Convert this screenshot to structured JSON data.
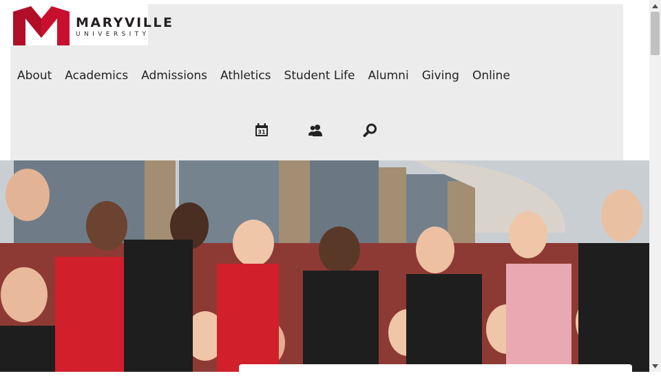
{
  "logo": {
    "name": "MARYVILLE",
    "sub": "UNIVERSITY",
    "brand_color": "#c8102e"
  },
  "nav": {
    "items": [
      {
        "label": "About"
      },
      {
        "label": "Academics"
      },
      {
        "label": "Admissions"
      },
      {
        "label": "Athletics"
      },
      {
        "label": "Student Life"
      },
      {
        "label": "Alumni"
      },
      {
        "label": "Giving"
      },
      {
        "label": "Online"
      }
    ]
  },
  "utility_icons": {
    "calendar_day": "31",
    "icons": [
      "calendar-icon",
      "user-group-icon",
      "search-icon"
    ]
  },
  "hero": {
    "image": "students-group-photo"
  }
}
